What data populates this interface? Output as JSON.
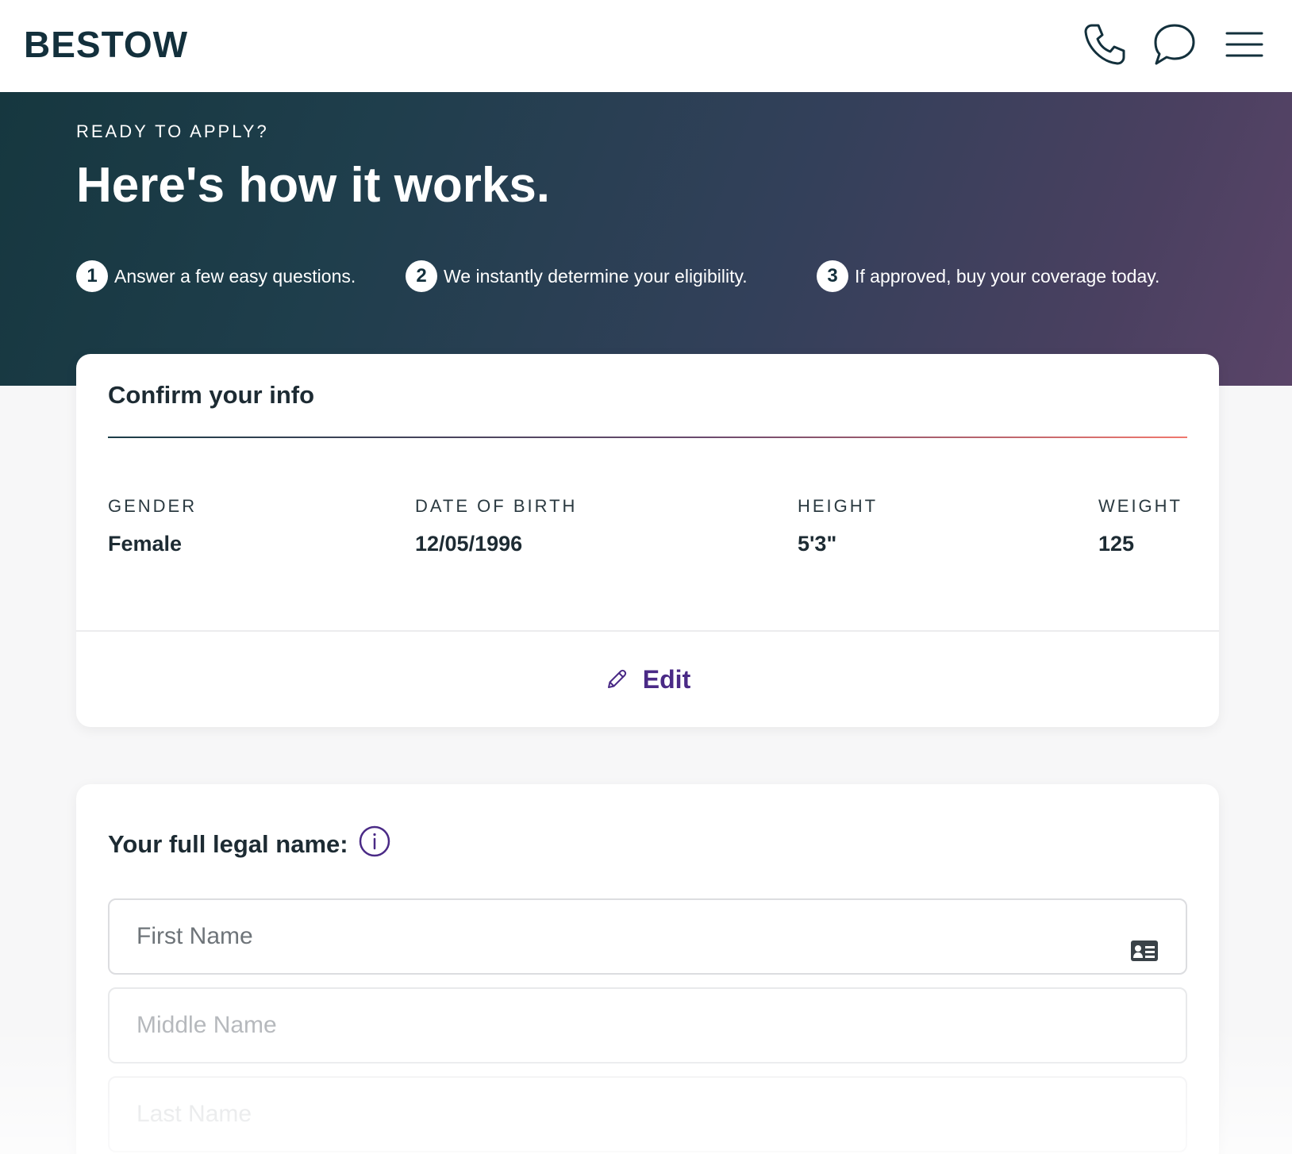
{
  "header": {
    "logo": "BESTOW",
    "icons": [
      "phone-icon",
      "chat-icon",
      "menu-icon"
    ]
  },
  "hero": {
    "eyebrow": "READY TO APPLY?",
    "title": "Here's how it works.",
    "steps": [
      {
        "number": "1",
        "text": "Answer a few easy questions."
      },
      {
        "number": "2",
        "text": "We instantly determine your eligibility."
      },
      {
        "number": "3",
        "text": "If approved, buy your coverage today."
      }
    ]
  },
  "confirm": {
    "title": "Confirm your info",
    "fields": [
      {
        "label": "GENDER",
        "value": "Female"
      },
      {
        "label": "DATE OF BIRTH",
        "value": "12/05/1996"
      },
      {
        "label": "HEIGHT",
        "value": "5'3\""
      },
      {
        "label": "WEIGHT",
        "value": "125"
      }
    ],
    "edit_label": "Edit"
  },
  "name_form": {
    "label": "Your full legal name:",
    "first_placeholder": "First Name",
    "middle_placeholder": "Middle Name",
    "last_placeholder": "Last Name",
    "first_value": "",
    "middle_value": "",
    "last_value": ""
  },
  "colors": {
    "brand_dark": "#13303c",
    "accent_purple": "#4a2a86",
    "rule_coral": "#f0786e"
  }
}
